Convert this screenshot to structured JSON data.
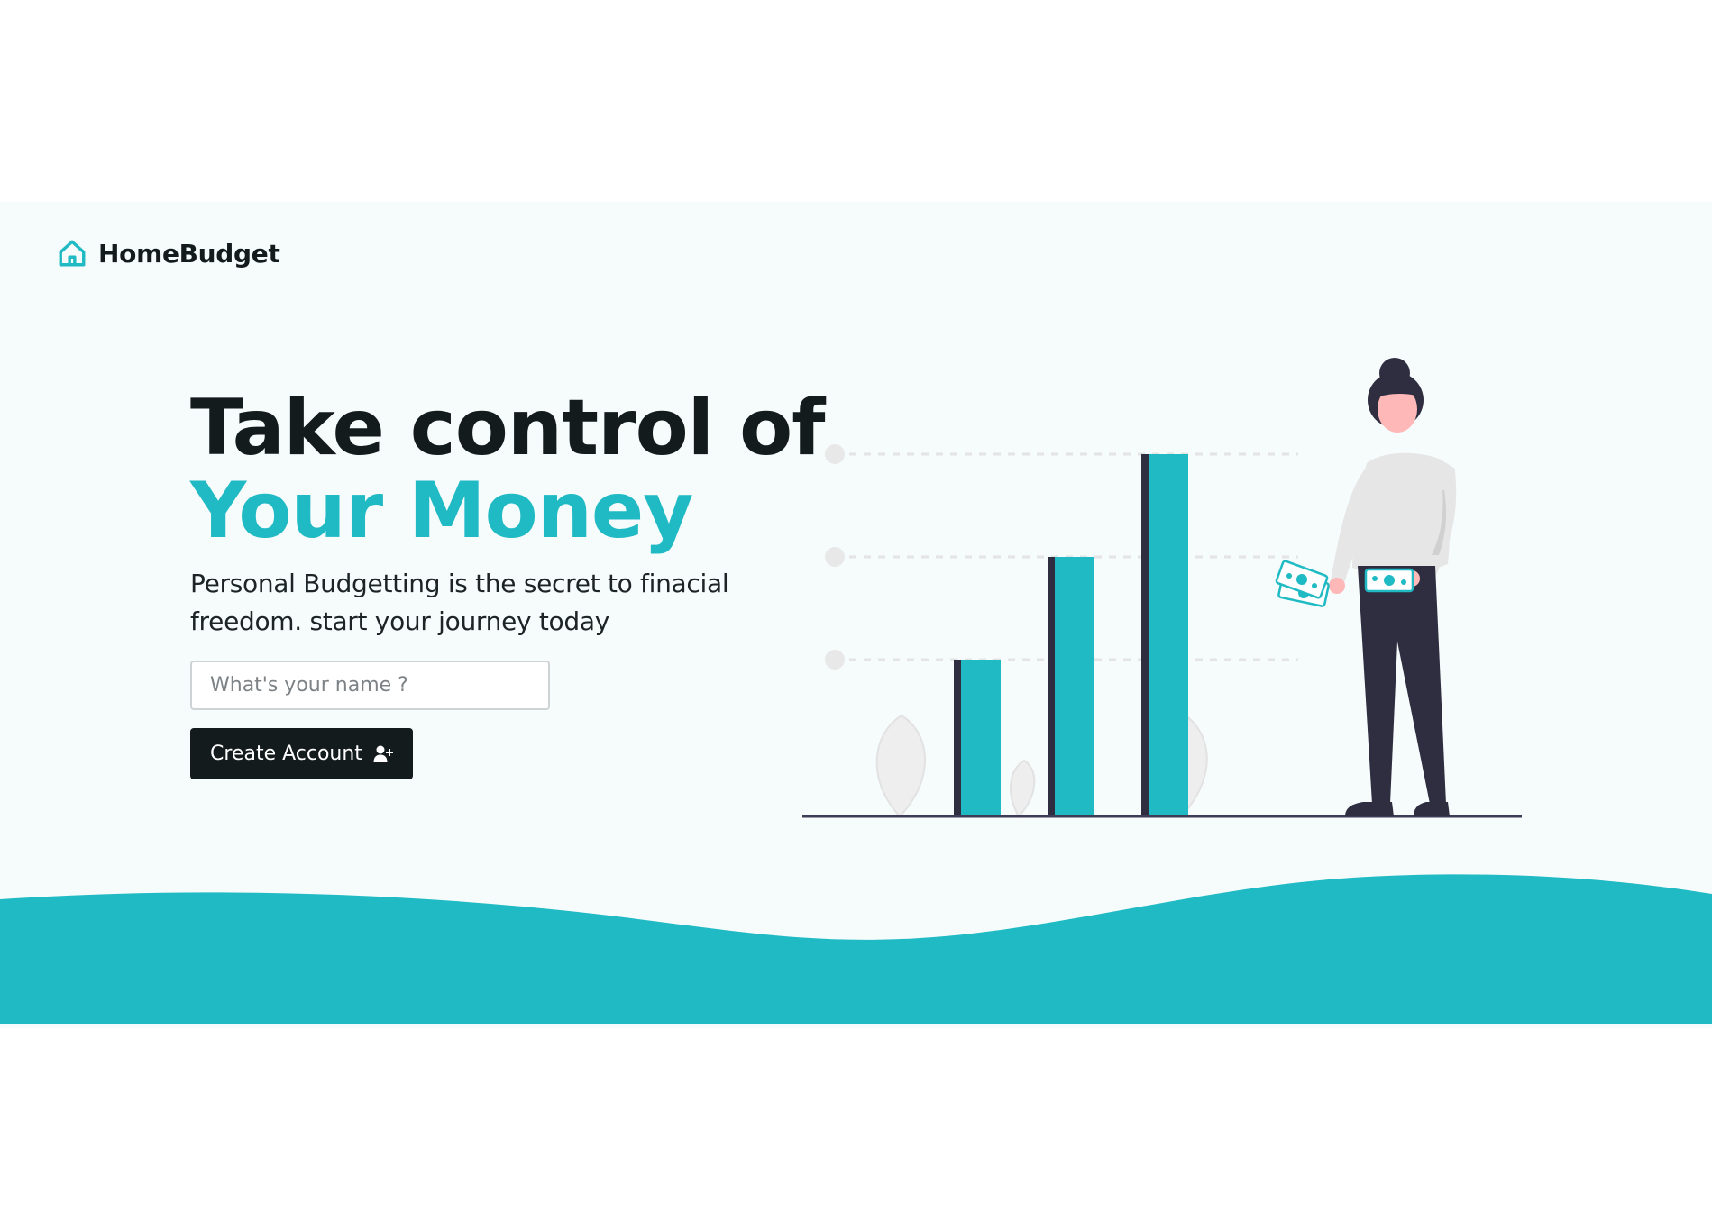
{
  "brand": {
    "name": "HomeBudget",
    "icon": "house-icon"
  },
  "hero": {
    "headline_line1": "Take control of",
    "headline_line2": "Your Money",
    "subtitle": "Personal Budgetting is the secret to finacial freedom. start your journey today",
    "name_placeholder": "What's your name ?",
    "cta_label": "Create Account",
    "cta_icon": "user-plus-icon"
  },
  "illustration": {
    "bars_relative_height": [
      0.41,
      0.7,
      1.0
    ],
    "icons": [
      "growth-bar-chart",
      "woman-holding-money"
    ]
  },
  "colors": {
    "accent": "#1fbac4",
    "dark": "#141b1d",
    "background": "#f6fbfb",
    "figure_dark": "#2f2e41"
  }
}
